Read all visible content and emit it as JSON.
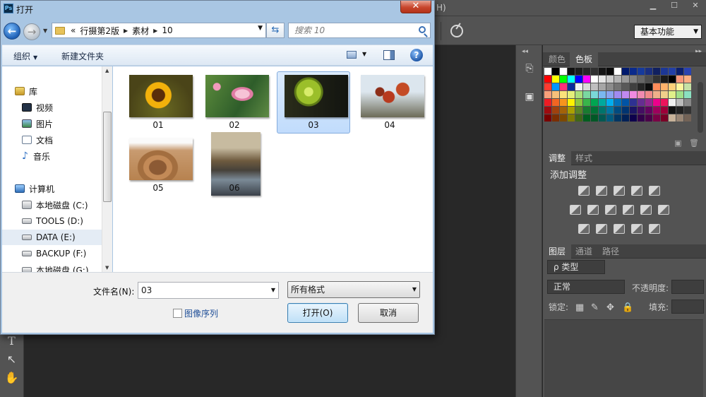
{
  "photoshop": {
    "menu_tail": "H)",
    "workspace": "基本功能",
    "toolbar_tools": [
      "T",
      "↖",
      "✋"
    ],
    "swatch_tabs": [
      "颜色",
      "色板"
    ],
    "adjust_tabs": [
      "调整",
      "样式"
    ],
    "adjust_title": "添加调整",
    "layer_tabs": [
      "图层",
      "通道",
      "路径"
    ],
    "layer_filter": "ρ 类型",
    "blend_mode": "正常",
    "opacity_label": "不透明度:",
    "lock_label": "锁定:",
    "fill_label": "填充:",
    "swatch_rows": [
      [
        "#ffffff",
        "#000000",
        "#ffffff",
        "#111111",
        "#1c1c1c",
        "#262626",
        "#303030",
        "#151515",
        "#0a0a0a",
        "#ffffff",
        "#001a6e",
        "#0a2a8c",
        "#163a9c",
        "#1a2f80",
        "#102060",
        "#1c3796",
        "#223fa6",
        "#0b1f6e",
        "#2a42b0"
      ],
      [
        "#ff0000",
        "#ffff00",
        "#00ff00",
        "#00ffff",
        "#0000ff",
        "#ff00ff",
        "#ffffff",
        "#e6e6e6",
        "#cccccc",
        "#b3b3b3",
        "#999999",
        "#808080",
        "#666666",
        "#4d4d4d",
        "#333333",
        "#1a1a1a",
        "#000000",
        "#f7977a",
        "#fbad82"
      ],
      [
        "#ff3b30",
        "#0096ff",
        "#ff2d7a",
        "#0b2a9c",
        "#f2f2f2",
        "#d9d9d9",
        "#bfbfbf",
        "#a6a6a6",
        "#8c8c8c",
        "#737373",
        "#595959",
        "#404040",
        "#262626",
        "#0d0d0d",
        "#ff8c5a",
        "#ffb36b",
        "#fdd17a",
        "#fff59d",
        "#c5e1a5"
      ],
      [
        "#f9a07a",
        "#f7c07a",
        "#fbe27a",
        "#e4ef7a",
        "#aadf7a",
        "#7ad8a0",
        "#7ad8d8",
        "#7ab8f0",
        "#8aa4f0",
        "#a08af0",
        "#c08af0",
        "#f08ae0",
        "#f08ab0",
        "#f08a8a",
        "#f0b08a",
        "#f0d08a",
        "#e0f08a",
        "#a0e08a",
        "#8ae0c0"
      ],
      [
        "#ed1c24",
        "#f26522",
        "#f7941d",
        "#fff200",
        "#8dc63f",
        "#39b54a",
        "#00a651",
        "#00a99d",
        "#00aeef",
        "#0072bc",
        "#0054a6",
        "#2e3192",
        "#662d91",
        "#92278f",
        "#ec008c",
        "#ed145b",
        "#f0f0f0",
        "#bbbbbb",
        "#888888"
      ],
      [
        "#9e0b0f",
        "#a0410d",
        "#a36209",
        "#aba000",
        "#598527",
        "#197b30",
        "#007236",
        "#00746b",
        "#0076a3",
        "#004b80",
        "#003471",
        "#1b1464",
        "#440e62",
        "#630460",
        "#9e005d",
        "#9e0039",
        "#111111",
        "#222222",
        "#333333"
      ],
      [
        "#790000",
        "#7b2e00",
        "#7d4900",
        "#827b00",
        "#406618",
        "#005e20",
        "#005826",
        "#005952",
        "#005b7f",
        "#003663",
        "#002157",
        "#0d004c",
        "#32004b",
        "#4b0049",
        "#7b0046",
        "#7a0026",
        "#c7b299",
        "#998675",
        "#736357"
      ]
    ]
  },
  "dialog": {
    "title": "打开",
    "close_label": "✕",
    "path": {
      "prefix": "«",
      "parts": [
        "行摄第2版",
        "素材",
        "10"
      ]
    },
    "search_placeholder": "搜索 10",
    "commands": {
      "organize": "组织",
      "new_folder": "新建文件夹"
    },
    "nav_items": [
      {
        "label": "库",
        "icon": "library-icon",
        "level": 0
      },
      {
        "label": "视频",
        "icon": "video-icon",
        "level": 1
      },
      {
        "label": "图片",
        "icon": "pictures-icon",
        "level": 1
      },
      {
        "label": "文档",
        "icon": "documents-icon",
        "level": 1
      },
      {
        "label": "音乐",
        "icon": "music-icon",
        "level": 1
      },
      {
        "label": "计算机",
        "icon": "computer-icon",
        "level": 0
      },
      {
        "label": "本地磁盘 (C:)",
        "icon": "system-drive-icon",
        "level": 1
      },
      {
        "label": "TOOLS (D:)",
        "icon": "drive-icon",
        "level": 1
      },
      {
        "label": "DATA (E:)",
        "icon": "drive-icon",
        "level": 1,
        "selected": true
      },
      {
        "label": "BACKUP (F:)",
        "icon": "drive-icon",
        "level": 1
      },
      {
        "label": "本地磁盘 (G:)",
        "icon": "drive-icon",
        "level": 1
      }
    ],
    "files": [
      {
        "name": "01",
        "image": "sunflower-thumbnail"
      },
      {
        "name": "02",
        "image": "lotus-thumbnail"
      },
      {
        "name": "03",
        "image": "chrysanthemum-thumbnail",
        "selected": true
      },
      {
        "name": "04",
        "image": "red-leaves-thumbnail"
      },
      {
        "name": "05",
        "image": "wood-stump-thumbnail"
      },
      {
        "name": "06",
        "image": "river-thumbnail"
      }
    ],
    "filename_label": "文件名(N):",
    "filename_value": "03",
    "filter_value": "所有格式",
    "sequence_label": "图像序列",
    "open_label": "打开(O)",
    "cancel_label": "取消"
  }
}
